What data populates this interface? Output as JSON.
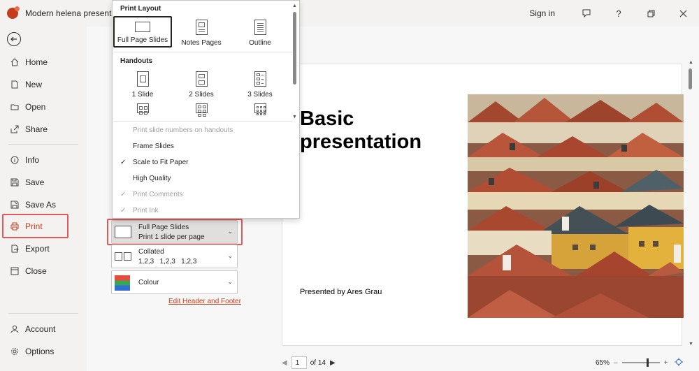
{
  "window": {
    "title": "Modern helena presentation",
    "signin": "Sign in",
    "icons": [
      "feedback-icon",
      "help-icon",
      "restore-icon",
      "close-icon"
    ],
    "help_glyph": "?"
  },
  "nav": {
    "items": [
      {
        "label": "Home",
        "icon": "home-icon"
      },
      {
        "label": "New",
        "icon": "new-document-icon"
      },
      {
        "label": "Open",
        "icon": "folder-icon"
      },
      {
        "label": "Share",
        "icon": "share-icon"
      },
      {
        "label": "Info",
        "icon": "info-icon"
      },
      {
        "label": "Save",
        "icon": "save-icon"
      },
      {
        "label": "Save As",
        "icon": "save-as-icon"
      },
      {
        "label": "Print",
        "icon": "printer-icon",
        "active": true
      },
      {
        "label": "Export",
        "icon": "export-icon"
      },
      {
        "label": "Close",
        "icon": "close-folder-icon"
      },
      {
        "label": "Account",
        "icon": "account-icon"
      },
      {
        "label": "Options",
        "icon": "options-icon"
      }
    ],
    "accent": "#c43e1c"
  },
  "print_settings": {
    "layout": {
      "line1": "Full Page Slides",
      "line2": "Print 1 slide per page"
    },
    "collation": {
      "line1": "Collated",
      "line2": "1,2,3   1,2,3   1,2,3"
    },
    "color": {
      "line1": "Colour"
    },
    "edit_link": "Edit Header and Footer"
  },
  "dropdown": {
    "print_layout_heading": "Print Layout",
    "print_layout_options": [
      "Full Page Slides",
      "Notes Pages",
      "Outline"
    ],
    "selected_layout": "Full Page Slides",
    "handouts_heading": "Handouts",
    "handout_options": [
      "1 Slide",
      "2 Slides",
      "3 Slides"
    ],
    "menu_items": [
      {
        "label": "Print slide numbers on handouts",
        "checked": false,
        "disabled": true
      },
      {
        "label": "Frame Slides",
        "checked": false,
        "disabled": false
      },
      {
        "label": "Scale to Fit Paper",
        "checked": true,
        "disabled": false
      },
      {
        "label": "High Quality",
        "checked": false,
        "disabled": false
      },
      {
        "label": "Print Comments",
        "checked": true,
        "disabled": true
      },
      {
        "label": "Print Ink",
        "checked": true,
        "disabled": true
      }
    ]
  },
  "preview": {
    "slide_title_line1": "Basic",
    "slide_title_line2": "presentation",
    "presenter": "Presented by Ares Grau",
    "image": "rooftops-photo"
  },
  "pager": {
    "current": "1",
    "total_label": "of 14"
  },
  "zoom": {
    "level": "65%",
    "level_value": 0.65,
    "minus": "–",
    "plus": "+"
  }
}
